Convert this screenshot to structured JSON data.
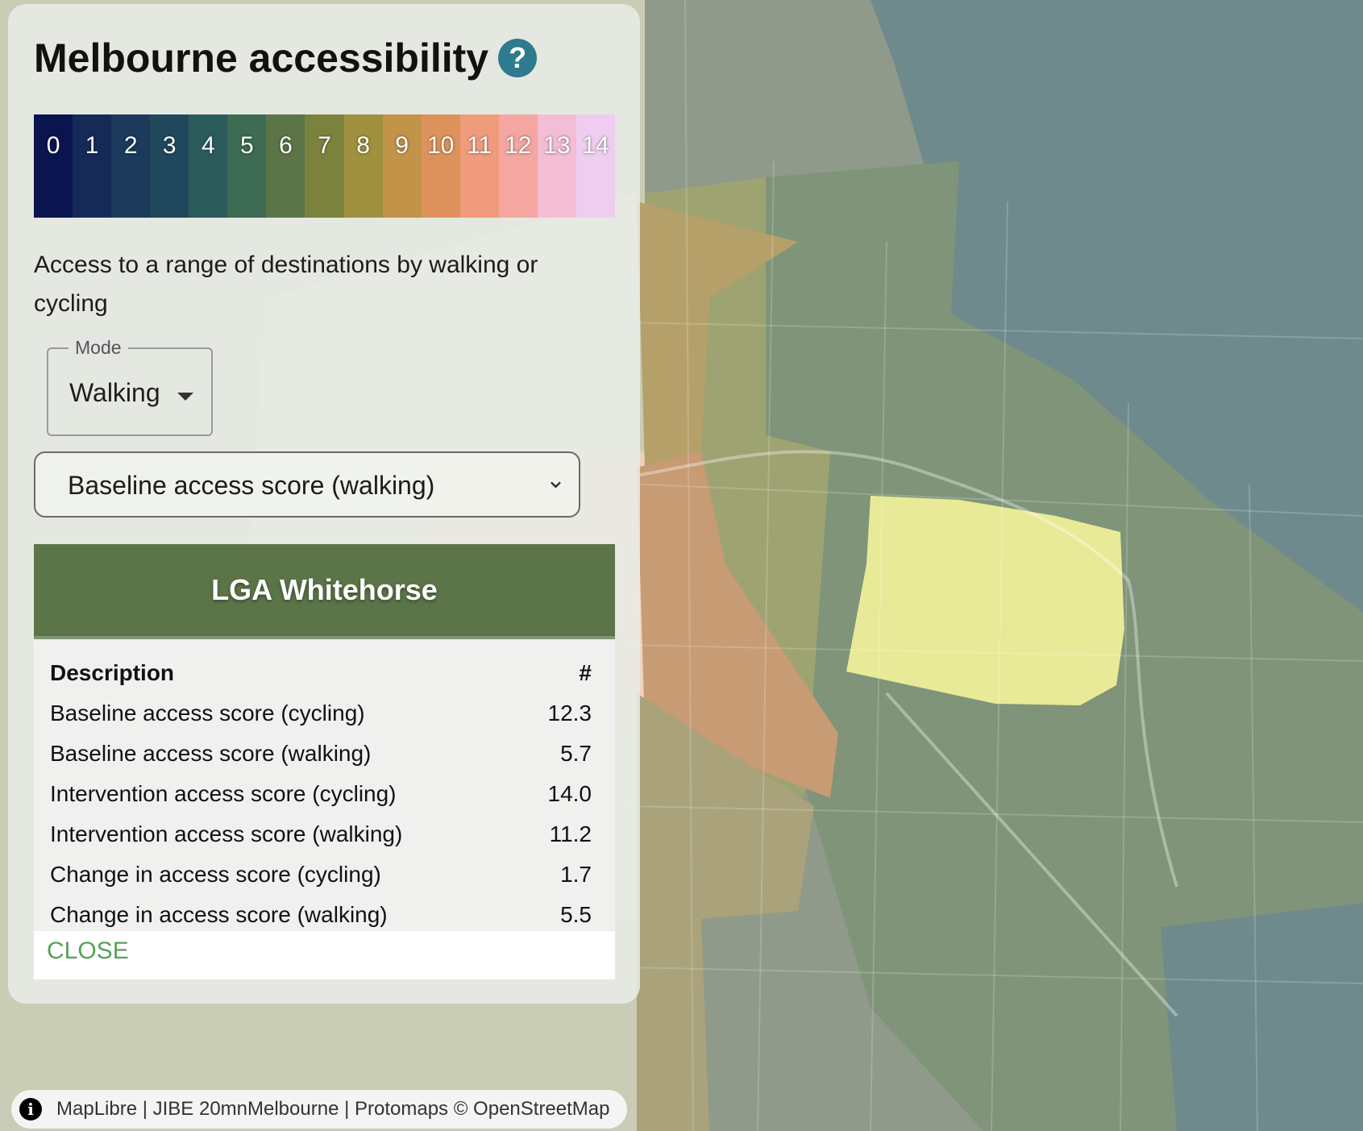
{
  "app": {
    "title": "Melbourne accessibility",
    "help_glyph": "?",
    "subtitle": "Access to a range of destinations by walking or cycling"
  },
  "legend": {
    "labels": [
      "0",
      "1",
      "2",
      "3",
      "4",
      "5",
      "6",
      "7",
      "8",
      "9",
      "10",
      "11",
      "12",
      "13",
      "14"
    ],
    "colors": [
      "#0a1550",
      "#162a58",
      "#1b3a5c",
      "#20485d",
      "#2c5b5c",
      "#3d6b54",
      "#5b7548",
      "#7b823e",
      "#9f913d",
      "#c2944a",
      "#de925b",
      "#ef9b7c",
      "#f5a6a1",
      "#f3bdd3",
      "#efcdf0"
    ]
  },
  "mode": {
    "label": "Mode",
    "value": "Walking"
  },
  "indicator_select": {
    "value": "Baseline access score (walking)"
  },
  "popup": {
    "title": "LGA Whitehorse",
    "header_description": "Description",
    "header_value": "#",
    "rows": [
      {
        "label": "Baseline access score (cycling)",
        "value": "12.3"
      },
      {
        "label": "Baseline access score (walking)",
        "value": "5.7"
      },
      {
        "label": "Intervention access score (cycling)",
        "value": "14.0"
      },
      {
        "label": "Intervention access score (walking)",
        "value": "11.2"
      },
      {
        "label": "Change in access score (cycling)",
        "value": "1.7"
      },
      {
        "label": "Change in access score (walking)",
        "value": "5.5"
      }
    ],
    "close_label": "CLOSE"
  },
  "attribution": {
    "text": "MapLibre | JIBE 20mnMelbourne | Protomaps © OpenStreetMap",
    "icon": "info-icon"
  },
  "map": {
    "highlight_color": "#e9ea97",
    "base_color": "#6f8a80"
  }
}
